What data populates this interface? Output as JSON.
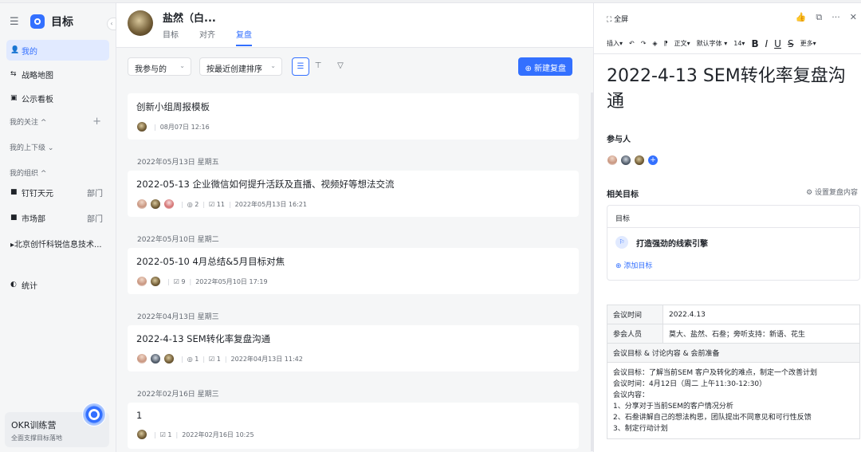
{
  "sidebar": {
    "app_title": "目标",
    "nav": [
      {
        "icon": "👤",
        "label": "我的"
      },
      {
        "icon": "⇆",
        "label": "战略地图"
      },
      {
        "icon": "▣",
        "label": "公示看板"
      }
    ],
    "section_follow": "我的关注 ^",
    "section_updown": "我的上下级 ⌄",
    "section_org": "我的组织 ^",
    "orgs": [
      {
        "label": "钉钉天元",
        "tag": "部门"
      },
      {
        "label": "市场部",
        "tag": "部门"
      }
    ],
    "company": "▸北京创忏科锐信息技术...",
    "stats": "统计",
    "card_title": "OKR训练营",
    "card_sub": "全面支撑目标落地"
  },
  "middle": {
    "user_name": "盐然（白...",
    "tabs": [
      "目标",
      "对齐",
      "复盘"
    ],
    "filter_participated": "我参与的",
    "sort_label": "按最近创建排序",
    "new_button": "⊕ 新建复盘",
    "cards": [
      {
        "title": "创新小组周报模板",
        "meta": "08月07日 12:16"
      },
      {
        "group": "2022年05月13日 星期五",
        "title": "2022-05-13 企业微信如何提升活跃及直播、视频好等想法交流",
        "comments": "◎ 2",
        "checks": "☑ 11",
        "meta": "2022年05月13日 16:21"
      },
      {
        "group": "2022年05月10日 星期二",
        "title": "2022-05-10 4月总结&5月目标对焦",
        "checks": "☑ 9",
        "meta": "2022年05月10日 17:19"
      },
      {
        "group": "2022年04月13日 星期三",
        "title": "2022-4-13 SEM转化率复盘沟通",
        "comments": "◎ 1",
        "checks": "☑ 1",
        "meta": "2022年04月13日 11:42"
      },
      {
        "group": "2022年02月16日 星期三",
        "title": "1",
        "checks": "☑ 1",
        "meta": "2022年02月16日 10:25"
      }
    ]
  },
  "panel": {
    "fullscreen": "⛶ 全屏",
    "actions": [
      "👍",
      "⧉",
      "···",
      "✕"
    ],
    "toolbar": [
      "插入▾",
      "↶",
      "↷",
      "◈",
      "⁋",
      "正文▾",
      "默认字体 ▾",
      "14▾",
      "B",
      "I",
      "U",
      "S",
      "更多▾"
    ],
    "title": "2022-4-13 SEM转化率复盘沟通",
    "participants_label": "参与人",
    "related_goals_label": "相关目标",
    "set_content": "⚙ 设置复盘内容",
    "goal_header": "目标",
    "goal": "打造强劲的线索引擎",
    "add_goal": "⊕ 添加目标",
    "table": {
      "time_key": "会议时间",
      "time_val": "2022.4.13",
      "people_key": "参会人员",
      "people_val": "莫大、盐然、石叁；旁听支持：新语、花生",
      "agenda_header": "会议目标 & 讨论内容 & 会前准备",
      "lines": [
        "会议目标：了解当前SEM 客户及转化的难点，制定一个改善计划",
        "会议时间：4月12日（周二 上午11:30-12:30）",
        "会议内容：",
        "1、分享对于当前SEM的客户情况分析",
        "2、石叁讲解自己的想法构思，团队提出不同意见和可行性反馈",
        "3、制定行动计划"
      ]
    }
  }
}
